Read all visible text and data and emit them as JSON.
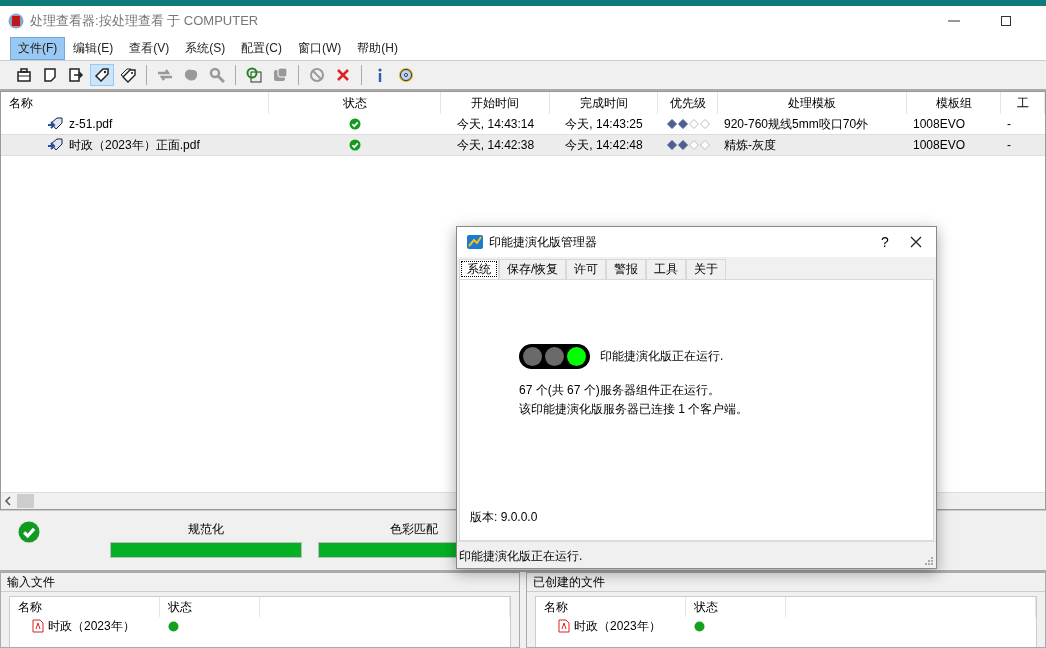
{
  "window": {
    "title": "处理查看器:按处理查看 于 COMPUTER"
  },
  "menu": [
    {
      "label": "文件(F)",
      "selected": true
    },
    {
      "label": "编辑(E)",
      "selected": false
    },
    {
      "label": "查看(V)",
      "selected": false
    },
    {
      "label": "系统(S)",
      "selected": false
    },
    {
      "label": "配置(C)",
      "selected": false
    },
    {
      "label": "窗口(W)",
      "selected": false
    },
    {
      "label": "帮助(H)",
      "selected": false
    }
  ],
  "toolbar": [
    [
      {
        "disabled": false,
        "selected": false
      },
      {
        "disabled": false,
        "selected": false
      },
      {
        "disabled": false,
        "selected": false
      },
      {
        "disabled": false,
        "selected": true
      },
      {
        "disabled": false,
        "selected": false
      }
    ],
    [
      {
        "disabled": true,
        "selected": false
      },
      {
        "disabled": true,
        "selected": false
      },
      {
        "disabled": true,
        "selected": false
      }
    ],
    [
      {
        "disabled": false,
        "selected": false
      },
      {
        "disabled": true,
        "selected": false
      }
    ],
    [
      {
        "disabled": true,
        "selected": false
      },
      {
        "disabled": false,
        "selected": false
      }
    ],
    [
      {
        "disabled": false,
        "selected": false
      },
      {
        "disabled": false,
        "selected": false
      }
    ]
  ],
  "jobs": {
    "columns": [
      "名称",
      "状态",
      "开始时间",
      "完成时间",
      "优先级",
      "处理模板",
      "模板组",
      "工"
    ],
    "rows": [
      {
        "name": "z-51.pdf",
        "done": true,
        "start": "今天, 14:43:14",
        "finish": "今天, 14:43:25",
        "stars": 2,
        "template": "920-760规线5mm咬口70外",
        "group": "1008EVO",
        "column_8": "-",
        "selected": false
      },
      {
        "name": "时政（2023年）正面.pdf",
        "done": true,
        "start": "今天, 14:42:38",
        "finish": "今天, 14:42:48",
        "stars": 2,
        "template": "精炼-灰度",
        "group": "1008EVO",
        "column_8": "-",
        "selected": true
      }
    ]
  },
  "progress": {
    "done": true,
    "stages": [
      {
        "label": "规范化",
        "level": 1
      },
      {
        "label": "色彩匹配",
        "level": 1
      }
    ]
  },
  "input_files": {
    "title": "输入文件",
    "columns": [
      "名称",
      "状态"
    ],
    "rows": [
      {
        "name": "时政（2023年）",
        "done": true
      }
    ]
  },
  "created_files": {
    "title": "已创建的文件",
    "columns": [
      "名称",
      "状态"
    ],
    "rows": [
      {
        "name": "时政（2023年）",
        "done": true
      }
    ]
  },
  "dialog": {
    "title": "印能捷演化版管理器",
    "help": "?",
    "tabs": [
      {
        "label": "系统",
        "selected": true
      },
      {
        "label": "保存/恢复",
        "selected": false
      },
      {
        "label": "许可",
        "selected": false
      },
      {
        "label": "警报",
        "selected": false
      },
      {
        "label": "工具",
        "selected": false
      },
      {
        "label": "关于",
        "selected": false
      }
    ],
    "lights": [
      {
        "on": false
      },
      {
        "on": false
      },
      {
        "on": true
      }
    ],
    "state_text": "印能捷演化版正在运行.",
    "lines": [
      "67 个(共 67 个)服务器组件正在运行。",
      "该印能捷演化版服务器已连接 1 个客户端。"
    ],
    "version": "版本: 9.0.0.0",
    "status_bar": "印能捷演化版正在运行."
  }
}
